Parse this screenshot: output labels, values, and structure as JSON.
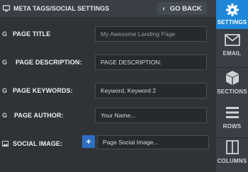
{
  "header": {
    "title": "META TAGS/SOCIAL SETTINGS",
    "back_label": "GO BACK"
  },
  "fields": [
    {
      "icon": "G",
      "label": "PAGE TITLE",
      "placeholder": "My Awesome Landing Page",
      "value": ""
    },
    {
      "icon": "G",
      "label": "PAGE DESCRIPTION:",
      "placeholder": "",
      "value": "PAGE DESCRIPTION:"
    },
    {
      "icon": "G",
      "label": "PAGE KEYWORDS:",
      "placeholder": "",
      "value": "Keyword, Keyword 2"
    },
    {
      "icon": "G",
      "label": "PAGE AUTHOR:",
      "placeholder": "",
      "value": "Your Name..."
    },
    {
      "icon": "image-icon",
      "label": "SOCIAL IMAGE:",
      "placeholder": "",
      "value": "Page Social Image..."
    }
  ],
  "rail": [
    {
      "label": "SETTINGS",
      "icon": "gear-icon",
      "active": true
    },
    {
      "label": "EMAIL",
      "icon": "envelope-icon",
      "active": false
    },
    {
      "label": "SECTIONS",
      "icon": "cube-icon",
      "active": false
    },
    {
      "label": "ROWS",
      "icon": "rows-icon",
      "active": false
    },
    {
      "label": "COLUMNS",
      "icon": "columns-icon",
      "active": false
    }
  ],
  "colors": {
    "accent": "#1e87d9",
    "plus_button": "#2d6fc2"
  },
  "social_add_label": "+"
}
